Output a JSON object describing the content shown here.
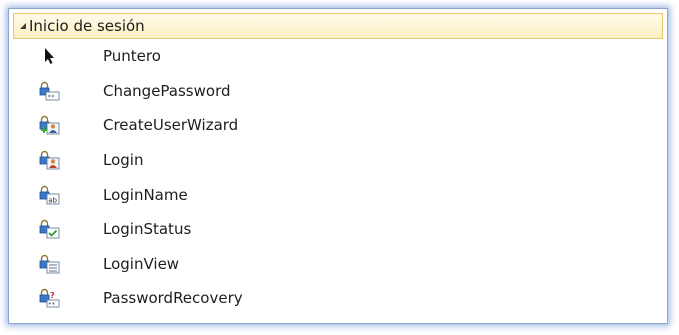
{
  "group": {
    "title": "Inicio de sesión"
  },
  "items": [
    {
      "label": "Puntero",
      "icon": "pointer-icon"
    },
    {
      "label": "ChangePassword",
      "icon": "change-password-icon"
    },
    {
      "label": "CreateUserWizard",
      "icon": "create-user-wizard-icon"
    },
    {
      "label": "Login",
      "icon": "login-icon"
    },
    {
      "label": "LoginName",
      "icon": "login-name-icon"
    },
    {
      "label": "LoginStatus",
      "icon": "login-status-icon"
    },
    {
      "label": "LoginView",
      "icon": "login-view-icon"
    },
    {
      "label": "PasswordRecovery",
      "icon": "password-recovery-icon"
    }
  ],
  "colors": {
    "header_border": "#e8c86a",
    "header_bg": "#fbefc4",
    "lock": "#d9b43a",
    "lock_body": "#3a78c8",
    "panel_glow": "#5082d2"
  }
}
